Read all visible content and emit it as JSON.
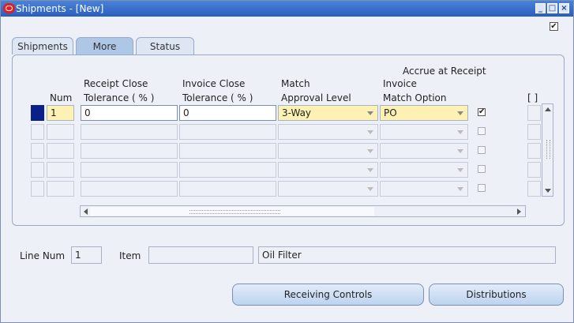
{
  "window": {
    "title": "Shipments - [New]"
  },
  "tabs": [
    {
      "label": "Shipments",
      "active": false
    },
    {
      "label": "More",
      "active": true
    },
    {
      "label": "Status",
      "active": false
    }
  ],
  "columns": {
    "num": "Num",
    "receipt_close_1": "Receipt Close",
    "receipt_close_2": "Tolerance ( % )",
    "invoice_close_1": "Invoice Close",
    "invoice_close_2": "Tolerance ( % )",
    "match_approval_1": "Match",
    "match_approval_2": "Approval Level",
    "invoice_match_1": "Invoice",
    "invoice_match_2": "Match Option",
    "accrue": "Accrue at Receipt",
    "bracket": "[ ]"
  },
  "rows": [
    {
      "num": "1",
      "receipt_close": "0",
      "invoice_close": "0",
      "match_level": "3-Way",
      "match_option": "PO",
      "accrue": true
    },
    {
      "num": "",
      "receipt_close": "",
      "invoice_close": "",
      "match_level": "",
      "match_option": "",
      "accrue": false
    },
    {
      "num": "",
      "receipt_close": "",
      "invoice_close": "",
      "match_level": "",
      "match_option": "",
      "accrue": false
    },
    {
      "num": "",
      "receipt_close": "",
      "invoice_close": "",
      "match_level": "",
      "match_option": "",
      "accrue": false
    },
    {
      "num": "",
      "receipt_close": "",
      "invoice_close": "",
      "match_level": "",
      "match_option": "",
      "accrue": false
    }
  ],
  "footer": {
    "line_num_label": "Line Num",
    "line_num_value": "1",
    "item_label": "Item",
    "item_value": "",
    "item_description": "Oil Filter"
  },
  "buttons": {
    "receiving_controls": "Receiving Controls",
    "distributions": "Distributions"
  },
  "colors": {
    "title_bar": "#2a5ebe",
    "required_field": "#fdf2b3",
    "selected_row": "#0b1f8a"
  }
}
